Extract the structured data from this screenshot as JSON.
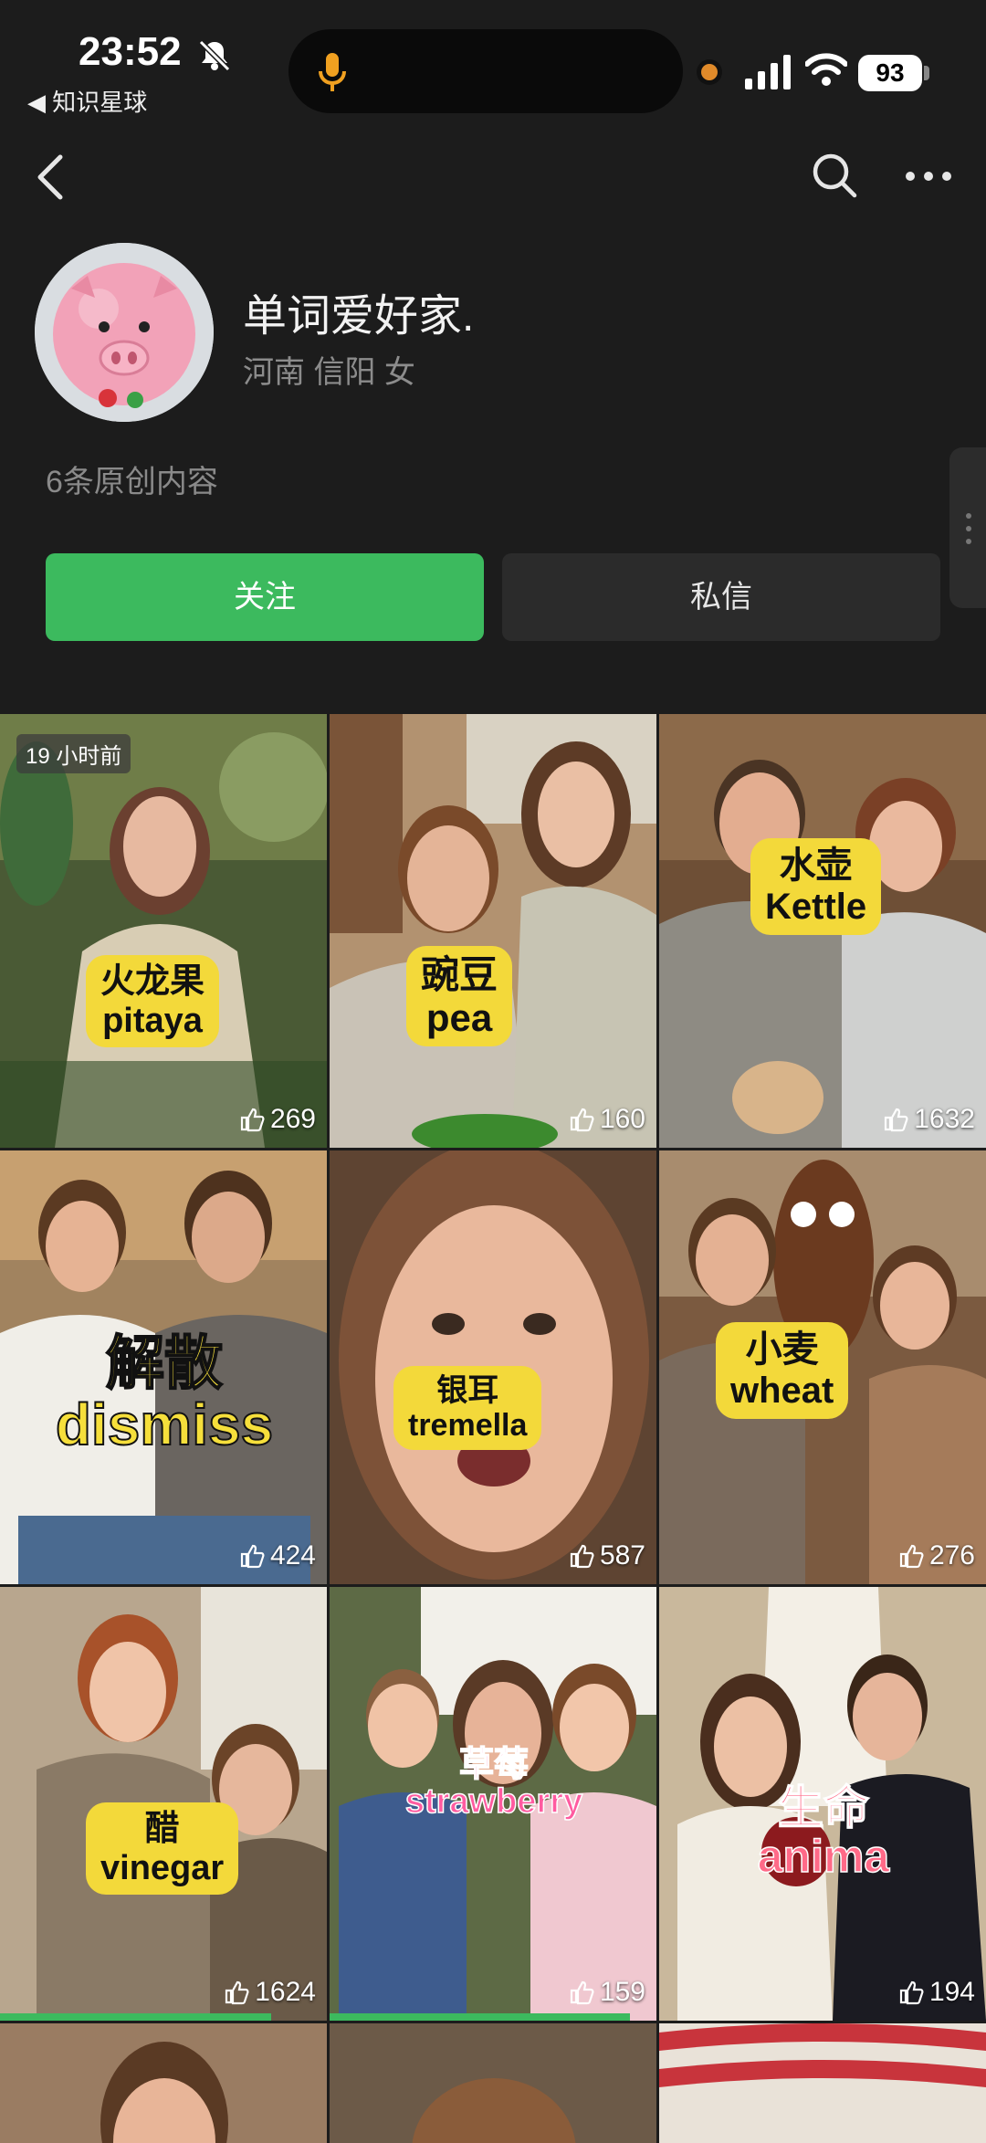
{
  "status_bar": {
    "time": "23:52",
    "back_app": "◀ 知识星球",
    "battery": "93"
  },
  "profile": {
    "name": "单词爱好家.",
    "location": "河南 信阳 女",
    "posts_count": "6条原创内容"
  },
  "actions": {
    "follow": "关注",
    "message": "私信"
  },
  "colors": {
    "accent": "#3cba5e",
    "label_yellow": "#f3d93a",
    "background": "#1c1c1c"
  },
  "videos": [
    {
      "zh": "火龙果",
      "en": "pitaya",
      "likes": "269",
      "time": "19 小时前"
    },
    {
      "zh": "豌豆",
      "en": "pea",
      "likes": "160"
    },
    {
      "zh": "水壶",
      "en": "Kettle",
      "likes": "1632"
    },
    {
      "zh": "解散",
      "en": "dismiss",
      "likes": "424"
    },
    {
      "zh": "银耳",
      "en": "tremella",
      "likes": "587"
    },
    {
      "zh": "小麦",
      "en": "wheat",
      "likes": "276"
    },
    {
      "zh": "醋",
      "en": "vinegar",
      "likes": "1624",
      "progress": 0.83
    },
    {
      "zh": "草莓",
      "en": "strawberry",
      "likes": "159",
      "progress": 0.92
    },
    {
      "zh": "生命",
      "en": "anima",
      "likes": "194"
    }
  ]
}
